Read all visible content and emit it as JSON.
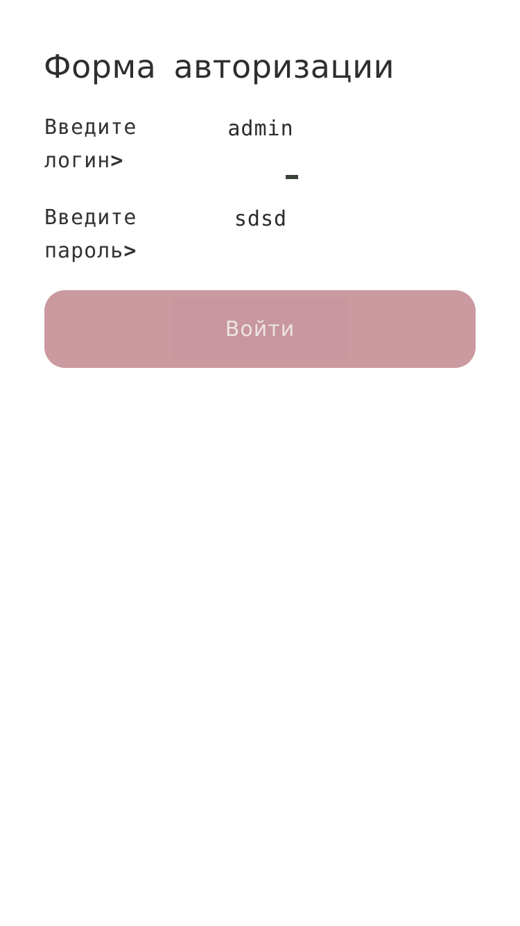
{
  "form": {
    "title": "Форма авторизации",
    "login_label": "Введите логин",
    "login_arrow": ">",
    "login_value": "admin",
    "password_label": "Введите пароль",
    "password_arrow": ">",
    "password_value": "sdsd",
    "submit_label": "Войти"
  },
  "colors": {
    "button_background": "#cb99a0",
    "button_text": "#ece3e5",
    "text": "#2e2e2e",
    "cursor": "#384238"
  }
}
